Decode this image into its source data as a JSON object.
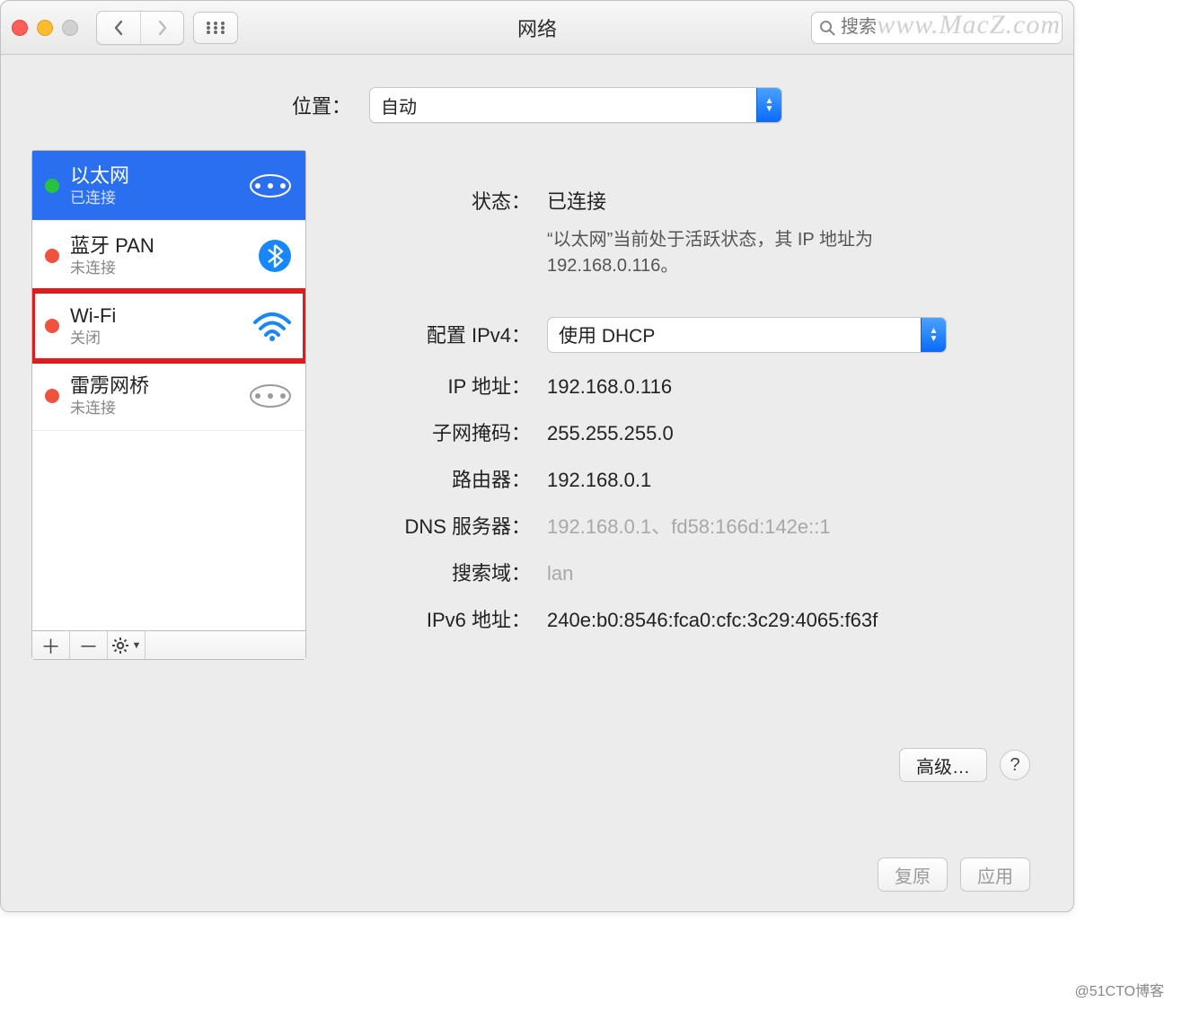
{
  "window": {
    "title": "网络"
  },
  "watermark": "www.MacZ.com",
  "search": {
    "placeholder": "搜索"
  },
  "location": {
    "label": "位置：",
    "value": "自动"
  },
  "services": [
    {
      "name": "以太网",
      "status": "已连接",
      "dot": "green",
      "icon": "ethernet",
      "selected": true
    },
    {
      "name": "蓝牙 PAN",
      "status": "未连接",
      "dot": "red",
      "icon": "bluetooth"
    },
    {
      "name": "Wi-Fi",
      "status": "关闭",
      "dot": "red",
      "icon": "wifi",
      "highlighted": true
    },
    {
      "name": "雷雳网桥",
      "status": "未连接",
      "dot": "red",
      "icon": "thunderbolt"
    }
  ],
  "detail": {
    "status_label": "状态：",
    "status_value": "已连接",
    "status_detail": "“以太网”当前处于活跃状态，其 IP 地址为 192.168.0.116。",
    "ipv4config_label": "配置 IPv4：",
    "ipv4config_value": "使用 DHCP",
    "ip_label": "IP 地址：",
    "ip_value": "192.168.0.116",
    "mask_label": "子网掩码：",
    "mask_value": "255.255.255.0",
    "router_label": "路由器：",
    "router_value": "192.168.0.1",
    "dns_label": "DNS 服务器：",
    "dns_value": "192.168.0.1、fd58:166d:142e::1",
    "searchdomain_label": "搜索域：",
    "searchdomain_value": "lan",
    "ipv6_label": "IPv6 地址：",
    "ipv6_value": "240e:b0:8546:fca0:cfc:3c29:4065:f63f"
  },
  "buttons": {
    "advanced": "高级…",
    "revert": "复原",
    "apply": "应用"
  },
  "attribution": "@51CTO博客"
}
